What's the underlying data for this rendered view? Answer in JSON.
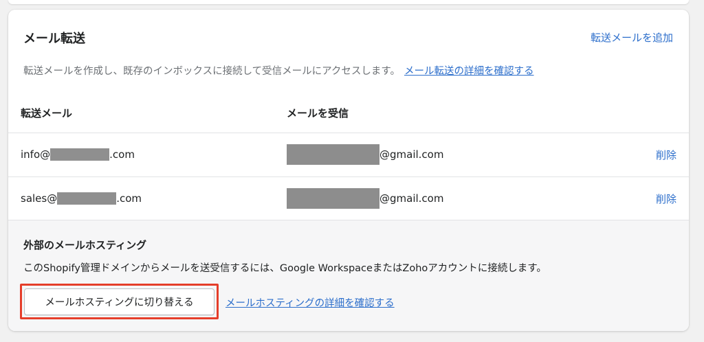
{
  "forwarding": {
    "title": "メール転送",
    "add_link": "転送メールを追加",
    "description": "転送メールを作成し、既存のインボックスに接続して受信メールにアクセスします。",
    "learn_link": "メール転送の詳細を確認する",
    "columns": {
      "forward": "転送メール",
      "receive": "メールを受信"
    },
    "rows": [
      {
        "forward_prefix": "info@",
        "forward_suffix": ".com",
        "receive_suffix": "@gmail.com",
        "delete_label": "削除"
      },
      {
        "forward_prefix": "sales@",
        "forward_suffix": ".com",
        "receive_suffix": "@gmail.com",
        "delete_label": "削除"
      }
    ]
  },
  "external": {
    "title": "外部のメールホスティング",
    "description": "このShopify管理ドメインからメールを送受信するには、Google WorkspaceまたはZohoアカウントに接続します。",
    "switch_button": "メールホスティングに切り替える",
    "learn_link": "メールホスティングの詳細を確認する"
  },
  "colors": {
    "link": "#2c6ecb",
    "highlight": "#e53e2a",
    "redaction": "#8f8f8f"
  }
}
